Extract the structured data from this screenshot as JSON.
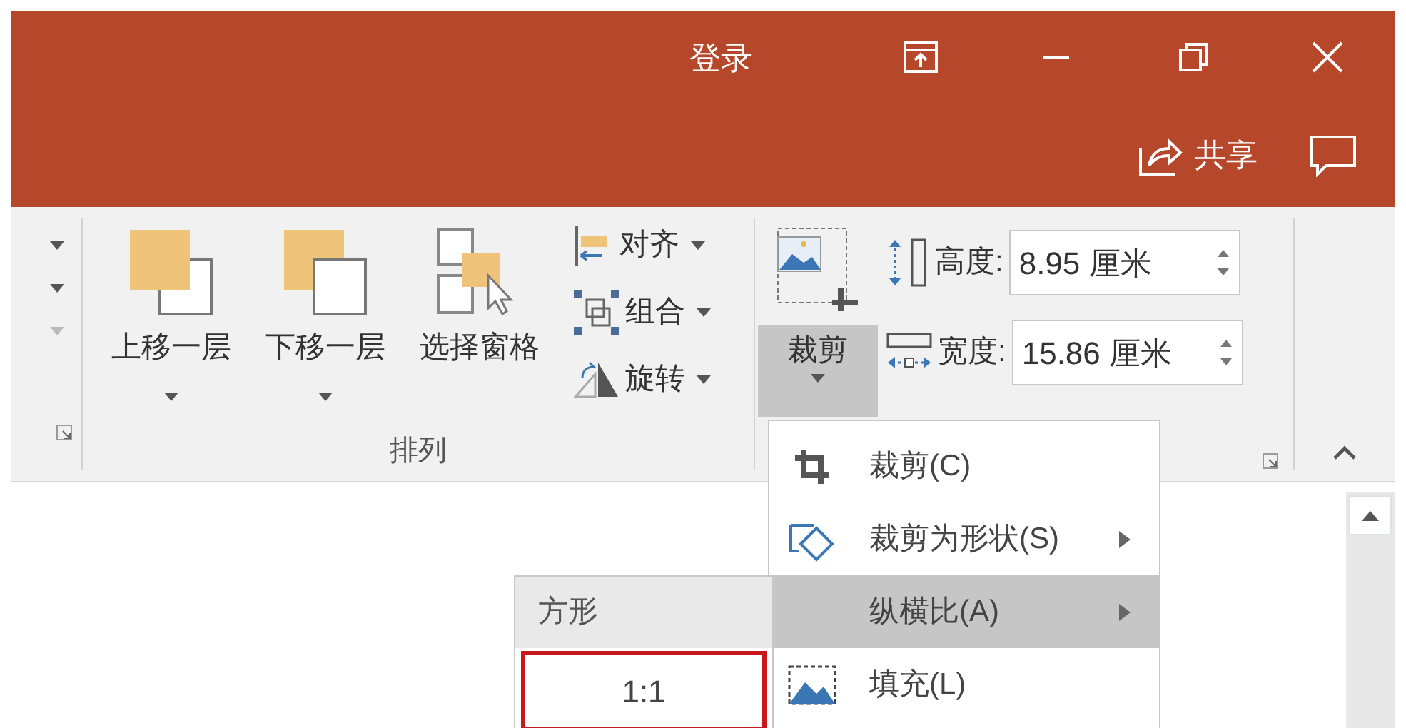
{
  "title_bar": {
    "sign_in": "登录",
    "share": "共享"
  },
  "ribbon": {
    "cut_group": {
      "dropdowns": [
        {
          "disabled": false
        },
        {
          "disabled": false
        },
        {
          "disabled": true
        }
      ]
    },
    "arrange": {
      "label": "排列",
      "large_buttons": [
        {
          "label": "上移一层",
          "has_dropdown": true
        },
        {
          "label": "下移一层",
          "has_dropdown": true
        },
        {
          "label": "选择窗格",
          "has_dropdown": false
        }
      ],
      "small_buttons": [
        {
          "label": "对齐"
        },
        {
          "label": "组合"
        },
        {
          "label": "旋转"
        }
      ]
    },
    "size": {
      "crop": {
        "label": "裁剪",
        "expanded": true
      },
      "fields": [
        {
          "kind": "height",
          "label": "高度:",
          "value": "8.95 厘米"
        },
        {
          "kind": "width",
          "label": "宽度:",
          "value": "15.86 厘米"
        }
      ]
    }
  },
  "crop_menu": {
    "items": [
      {
        "label": "裁剪(C)",
        "has_submenu": false,
        "selected": false
      },
      {
        "label": "裁剪为形状(S)",
        "has_submenu": true,
        "selected": false
      },
      {
        "label": "纵横比(A)",
        "has_submenu": true,
        "selected": true
      },
      {
        "label": "填充(L)",
        "has_submenu": false,
        "selected": false
      }
    ]
  },
  "aspect_submenu": {
    "header": "方形",
    "items": [
      {
        "label": "1:1",
        "highlighted": true
      }
    ]
  }
}
